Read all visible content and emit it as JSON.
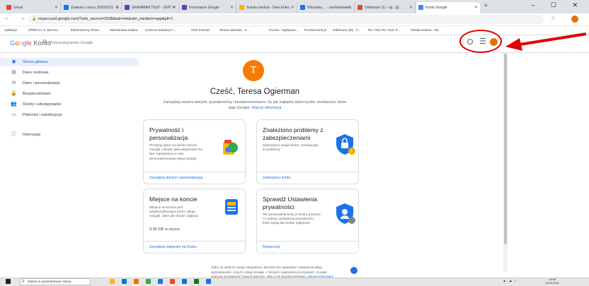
{
  "browser": {
    "tabs": [
      {
        "label": "Gmail",
        "color": "#ea4335"
      },
      {
        "label": "Zadania i oceny 2020/2021 - 2 ...",
        "color": "#1a73e8"
      },
      {
        "label": "GRAMMAR TEST - UNIT 4",
        "color": "#673ab7"
      },
      {
        "label": "Formularze Google",
        "color": "#673ab7"
      },
      {
        "label": "Szkoła średnia - New Enter...",
        "color": "#f4b400"
      },
      {
        "label": "Wirtualna ... - wortalneweb...",
        "color": "#1a73e8"
      },
      {
        "label": "Odebrane (1) - sp...@...",
        "color": "#ea4335"
      },
      {
        "label": "Konto Google",
        "color": "#4285f4"
      }
    ],
    "new_tab": "+",
    "window_controls": "– ☐ ✕",
    "nav": "← → ↻",
    "url": "myaccount.google.com/?utm_source=OGB&tab=mk&utm_medium=app&pli=1",
    "bookmarks": [
      "Aplikacje",
      "ZPRM im. S. Borzeo...",
      "Elektroniczny Dzien...",
      "Ministerstwo Eduka...",
      "Centrum Edukacji A...",
      "OKE Poznań",
      "Strona startowa - S...",
      "Poczta - Najlepsza...",
      "Poczta home.pl",
      "Odebrane (35) - b...",
      "Re: Fwd: Re: Fwd: R...",
      "Szkoła średnia - Ne..."
    ]
  },
  "header": {
    "logo_letters": [
      "G",
      "o",
      "o",
      "g",
      "l",
      "e"
    ],
    "logo_suffix": "Konto",
    "search_placeholder": "Przeszukaj konto Google",
    "apps_glyph": "☰"
  },
  "sidebar": {
    "items": [
      {
        "label": "Strona główna",
        "icon": "home-icon",
        "glyph": "◉",
        "active": true
      },
      {
        "label": "Dane osobowe",
        "icon": "id-card-icon",
        "glyph": "▤",
        "active": false
      },
      {
        "label": "Dane i personalizacja",
        "icon": "toggle-icon",
        "glyph": "⊖",
        "active": false
      },
      {
        "label": "Bezpieczeństwo",
        "icon": "lock-icon",
        "glyph": "🔒",
        "active": false
      },
      {
        "label": "Osoby i udostępnianie",
        "icon": "people-icon",
        "glyph": "👥",
        "active": false
      },
      {
        "label": "Płatności i subskrypcje",
        "icon": "card-icon",
        "glyph": "▭",
        "active": false
      },
      {
        "label": "Informacje",
        "icon": "info-icon",
        "glyph": "ⓘ",
        "active": false
      }
    ]
  },
  "main": {
    "avatar_initial": "T",
    "greeting": "Cześć, Teresa Ogierman",
    "subtitle": "Zarządzaj swoimi danymi, prywatnością i bezpieczeństwem, by jak najlepiej wykorzystać możliwości, które daje Google.",
    "subtitle_link": "Więcej informacji",
    "cards": [
      {
        "title": "Prywatność i personalizacja",
        "desc": "Przejrzyj dane na swoim koncie Google i określ, jaka aktywność ma być zapisywana w celu personalizowania usług Google",
        "footer": "Zarządzaj danymi i personalizacją"
      },
      {
        "title": "Znaleziono problemy z zabezpieczeniami",
        "desc": "Zabezpiecz swoje konto, rozwiązując te problemy",
        "footer": "Zabezpiecz konto"
      },
      {
        "title": "Miejsce na koncie",
        "desc": "Miejsce na koncie jest współużytkowane przez usługi Google, takie jak Gmail i Zdjęcia",
        "extra": "0,06 GB w użyciu",
        "footer": "Zarządzaj miejscem na Dysku"
      },
      {
        "title": "Sprawdź Ustawienia prywatności",
        "desc": "Ten przewodnik krok po kroku pomoże Ci wybrać ustawienia prywatności, które będą dla Ciebie najlepsze",
        "footer": "Rozpocznij"
      }
    ],
    "footer_note": "Tylko Ty widzisz swoje ustawienia. Możesz też sprawdzić ustawienia Map, wyszukiwarki i innych usług Google, z których najczęściej korzystasz. Google szanuje prywatność Twoich danych i dba o ich bezpieczeństwo.",
    "footer_link": "Więcej informacji"
  },
  "annotation": {
    "circle_color": "#e20000",
    "arrow_color": "#e20000"
  },
  "taskbar": {
    "search_placeholder": "Wpisz tu wyszukiwane słowa",
    "clock_time": "14:08",
    "clock_date": "14.04.2021",
    "app_colors": [
      "#ffb900",
      "#0078d4",
      "#e8710a",
      "#34a853",
      "#1a73e8",
      "#ea4335",
      "#0078d4",
      "#107c10",
      "#1a73e8"
    ]
  }
}
